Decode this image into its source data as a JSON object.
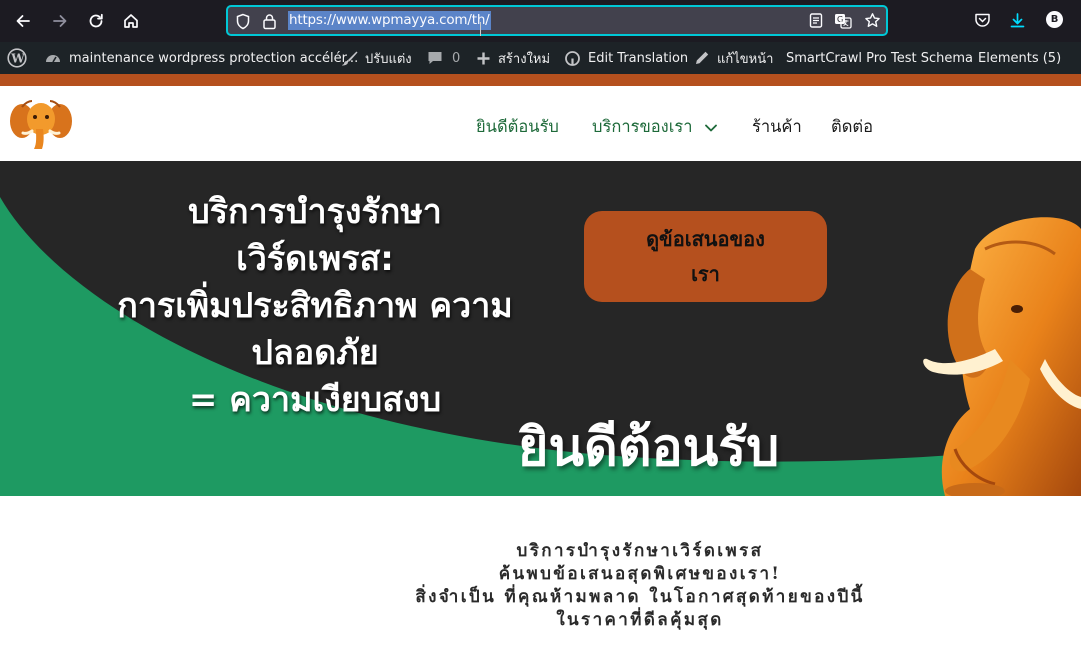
{
  "browser": {
    "url": "https://www.wpmayya.com/th/",
    "profile_initial": "B",
    "accent": "#00c8d7"
  },
  "admin_bar": {
    "site_name": "maintenance wordpress protection accélér...",
    "customize": "ปรับแต่ง",
    "comments_count": "0",
    "new": "สร้างใหม่",
    "edit_translation": "Edit Translation",
    "edit_page": "แก้ไขหน้า",
    "smartcrawl": "SmartCrawl Pro",
    "test_schema": "Test Schema",
    "elements": "Elements (5)"
  },
  "nav": {
    "home": "ยินดีต้อนรับ",
    "services": "บริการของเรา",
    "shop": "ร้านค้า",
    "contact": "ติดต่อ"
  },
  "hero": {
    "title_lines": [
      "บริการบำรุงรักษา",
      "เวิร์ดเพรส:",
      "การเพิ่มประสิทธิภาพ ความ",
      "ปลอดภัย",
      "= ความเงียบสงบ"
    ],
    "cta_line1": "ดูข้อเสนอของ",
    "cta_line2": "เรา",
    "welcome": "ยินดีต้อนรับ"
  },
  "intro": {
    "lines": [
      "บริการบำรุงรักษาเวิร์ดเพรส",
      "ค้นพบข้อเสนอสุดพิเศษของเรา!",
      "สิ่งจำเป็น ที่คุณห้ามพลาด ในโอกาศสุดท้ายของปีนี้",
      "ในราคาที่ดีลคุ้มสุด"
    ]
  },
  "colors": {
    "brand_orange": "#b5501e",
    "hero_green": "#1e9a62",
    "hero_dark": "#262626",
    "nav_green": "#1e6a3a"
  }
}
